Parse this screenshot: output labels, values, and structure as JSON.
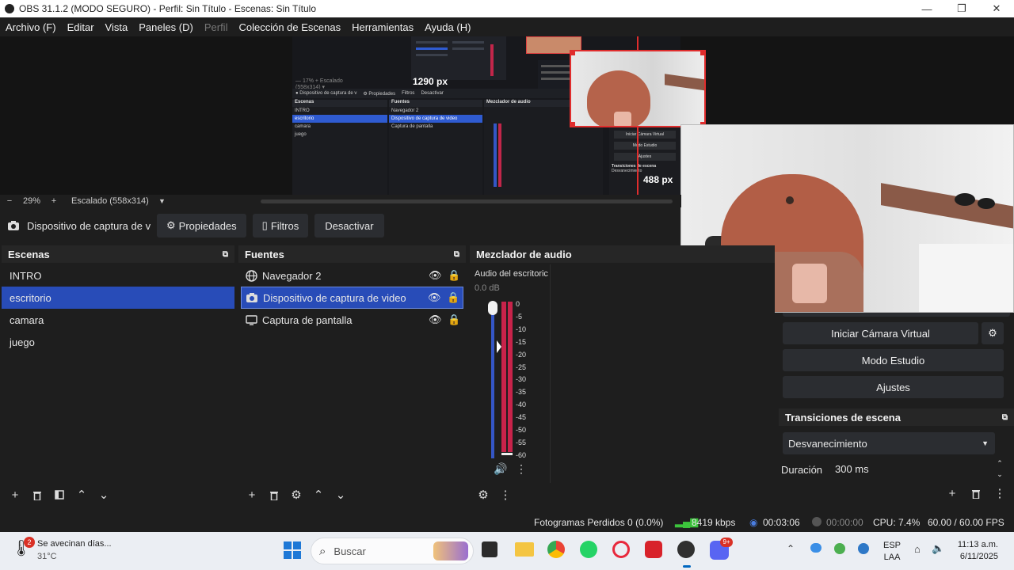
{
  "window": {
    "title": "OBS 31.1.2 (MODO SEGURO) - Perfil: Sin Título - Escenas: Sin Título",
    "minimize": "—",
    "maximize": "❐",
    "close": "✕"
  },
  "menu": [
    "Archivo (F)",
    "Editar",
    "Vista",
    "Paneles (D)",
    "Perfil",
    "Colección de Escenas",
    "Herramientas",
    "Ayuda (H)"
  ],
  "preview": {
    "width_label": "1290 px",
    "height_label": "488 px",
    "zoom_percent": "29%",
    "scale_label": "Escalado (558x314)"
  },
  "source_toolbar": {
    "source_name": "Dispositivo de captura de v",
    "properties": "Propiedades",
    "filters": "Filtros",
    "deactivate": "Desactivar"
  },
  "scenes": {
    "title": "Escenas",
    "items": [
      "INTRO",
      "escritorio",
      "camara",
      "juego"
    ],
    "selected_index": 1
  },
  "sources": {
    "title": "Fuentes",
    "items": [
      {
        "label": "Navegador 2",
        "icon": "globe-icon"
      },
      {
        "label": "Dispositivo de captura de video",
        "icon": "camera-icon"
      },
      {
        "label": "Captura de pantalla",
        "icon": "monitor-icon"
      }
    ],
    "selected_index": 1
  },
  "mixer": {
    "title": "Mezclador de audio",
    "channel": "Audio del escritoric",
    "db": "0.0 dB",
    "ticks": [
      "0",
      "-5",
      "-10",
      "-15",
      "-20",
      "-25",
      "-30",
      "-35",
      "-40",
      "-45",
      "-50",
      "-55",
      "-60"
    ]
  },
  "controls": {
    "virtual_cam": "Iniciar Cámara Virtual",
    "studio_mode": "Modo Estudio",
    "settings": "Ajustes"
  },
  "transitions": {
    "title": "Transiciones de escena",
    "selected": "Desvanecimiento",
    "duration_label": "Duración",
    "duration_value": "300 ms"
  },
  "status": {
    "dropped_frames": "Fotogramas Perdidos 0 (0.0%)",
    "bitrate": "8419 kbps",
    "stream_time": "00:03:06",
    "rec_time": "00:00:00",
    "cpu": "CPU: 7.4%",
    "fps": "60.00 / 60.00 FPS"
  },
  "taskbar": {
    "weather_badge": "2",
    "weather_title": "Se avecinan días...",
    "weather_temp": "31°C",
    "search_placeholder": "Buscar",
    "lang_line1": "ESP",
    "lang_line2": "LAA",
    "time": "11:13 a.m.",
    "date": "6/11/2025",
    "discord_badge": "9+"
  },
  "mini_preview": {
    "scenes_head": "Escenas",
    "sources_head": "Fuentes",
    "mixer_head": "Mezclador de audio",
    "mini_scenes": [
      "INTRO",
      "escritorio",
      "camara",
      "juego"
    ],
    "mini_sources": [
      "Navegador 2",
      "Dispositivo de captura de video",
      "Captura de pantalla"
    ],
    "mini_controls": [
      "Iniciar Cámara Virtual",
      "Modo Estudio",
      "Ajustes"
    ],
    "mini_trans": "Transiciones de escena",
    "mini_trans_sel": "Desvanecimiento"
  }
}
